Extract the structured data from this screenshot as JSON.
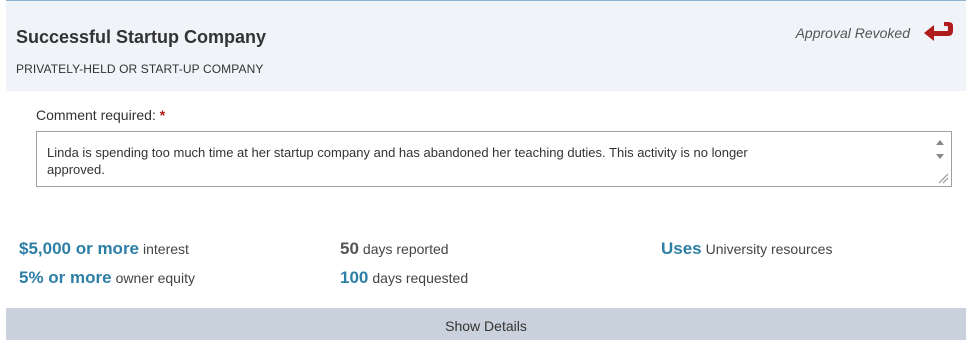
{
  "card": {
    "title": "Successful Startup Company",
    "subtitle": "PRIVATELY-HELD OR START-UP COMPANY",
    "status_text": "Approval Revoked",
    "status_icon": "return-arrow-icon",
    "status_color": "#b01c1c"
  },
  "comment": {
    "label": "Comment required:",
    "required_marker": "*",
    "value": "Linda is spending too much time at her startup company and has abandoned her teaching duties. This activity is no longer\napproved."
  },
  "metrics": {
    "interest_value": "$5,000 or more",
    "interest_label": "interest",
    "equity_value": "5% or more",
    "equity_label": "owner equity",
    "days_reported_value": "50",
    "days_reported_label": "days reported",
    "days_requested_value": "100",
    "days_requested_label": "days requested",
    "resources_value": "Uses",
    "resources_label": "University resources"
  },
  "footer": {
    "show_details_label": "Show Details"
  },
  "colors": {
    "accent": "#2e7fa6",
    "header_bg": "#f0f3f8",
    "footer_bg": "#c9d1dc"
  }
}
